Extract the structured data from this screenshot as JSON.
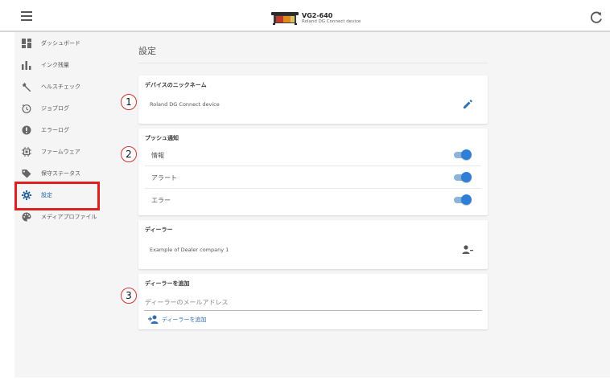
{
  "header": {
    "device_title": "VG2-640",
    "device_subtitle": "Roland DG Connect device"
  },
  "sidebar": {
    "items": [
      {
        "label": "ダッシュボード",
        "icon": "dashboard-icon"
      },
      {
        "label": "インク残量",
        "icon": "bar-chart-icon"
      },
      {
        "label": "ヘルスチェック",
        "icon": "wrench-icon"
      },
      {
        "label": "ジョブログ",
        "icon": "history-icon"
      },
      {
        "label": "エラーログ",
        "icon": "error-icon"
      },
      {
        "label": "ファームウェア",
        "icon": "chip-icon"
      },
      {
        "label": "保守ステータス",
        "icon": "tag-icon"
      },
      {
        "label": "設定",
        "icon": "gear-icon",
        "active": true
      },
      {
        "label": "メディアプロファイル",
        "icon": "palette-icon"
      }
    ]
  },
  "main": {
    "title": "設定",
    "nickname_card": {
      "title": "デバイスのニックネーム",
      "value": "Roland DG Connect device"
    },
    "push_card": {
      "title": "プッシュ通知",
      "rows": [
        {
          "label": "情報",
          "enabled": true
        },
        {
          "label": "アラート",
          "enabled": true
        },
        {
          "label": "エラー",
          "enabled": true
        }
      ]
    },
    "dealer_card": {
      "title": "ディーラー",
      "value": "Example of Dealer company 1"
    },
    "add_dealer_card": {
      "title": "ディーラーを追加",
      "placeholder": "ディーラーのメールアドレス",
      "add_label": "ディーラーを追加"
    }
  },
  "callouts": [
    "1",
    "2",
    "3"
  ],
  "colors": {
    "accent": "#2f7ed8",
    "highlight": "#e0201f"
  }
}
